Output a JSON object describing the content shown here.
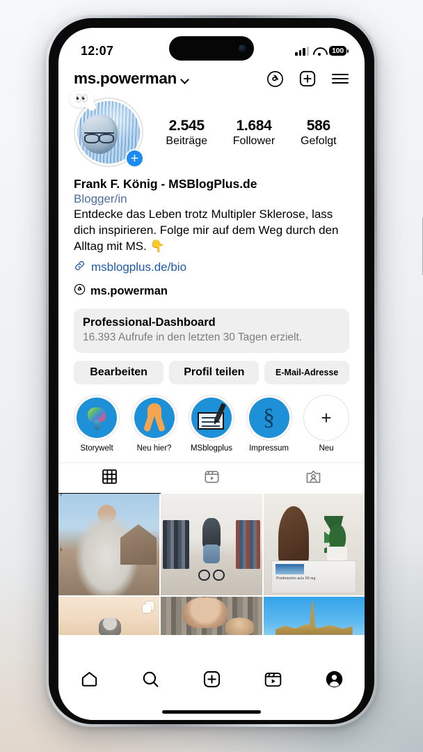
{
  "statusbar": {
    "time": "12:07",
    "battery": "100",
    "signal_icon": "cellular-bars-icon",
    "wifi_icon": "wifi-icon",
    "battery_icon": "battery-icon"
  },
  "header": {
    "username": "ms.powerman",
    "chevron_icon": "chevron-down-icon",
    "threads_icon": "threads-icon",
    "create_icon": "plus-square-icon",
    "menu_icon": "hamburger-menu-icon"
  },
  "profile": {
    "avatar_note": "👀",
    "avatar_add_label": "+",
    "stats": [
      {
        "number": "2.545",
        "label": "Beiträge"
      },
      {
        "number": "1.684",
        "label": "Follower"
      },
      {
        "number": "586",
        "label": "Gefolgt"
      }
    ]
  },
  "bio": {
    "name": "Frank F. König - MSBlogPlus.de",
    "category": "Blogger/in",
    "text": "Entdecke das Leben trotz Multipler Sklerose, lass dich inspirieren. Folge mir auf dem Weg durch den Alltag mit MS. 👇",
    "link_icon": "link-icon",
    "link": "msblogplus.de/bio",
    "threads_icon": "threads-icon",
    "threads_handle": "ms.powerman"
  },
  "dashboard": {
    "title": "Professional-Dashboard",
    "subtitle": "16.393 Aufrufe in den letzten 30 Tagen erzielt."
  },
  "actions": {
    "edit": "Bearbeiten",
    "share": "Profil teilen",
    "email": "E-Mail-Adresse"
  },
  "highlights": [
    {
      "label": "Storywelt",
      "icon": "elephant-icon"
    },
    {
      "label": "Neu hier?",
      "icon": "awareness-ribbon-icon"
    },
    {
      "label": "MSblogplus",
      "icon": "pen-and-card-icon"
    },
    {
      "label": "Impressum",
      "icon": "paragraph-symbol-icon"
    },
    {
      "label": "Neu",
      "icon": "plus-icon"
    }
  ],
  "tabs": [
    {
      "name": "grid",
      "icon": "grid-icon",
      "active": true
    },
    {
      "name": "reels",
      "icon": "reels-icon",
      "active": false
    },
    {
      "name": "tagged",
      "icon": "tagged-person-icon",
      "active": false
    }
  ],
  "grid_posts": [
    {
      "alt": "Mann im grauen Hoodie vor Haus und kahlem Baum",
      "type": "photo"
    },
    {
      "alt": "Person im Rollstuhl in einem Bekleidungsgeschäft",
      "type": "photo"
    },
    {
      "alt": "Buddha-Figur mit Pflanze und Prednisolon acis 50 mg Medikamentenschachtel",
      "type": "photo"
    },
    {
      "alt": "Person vor hellem Hintergrund",
      "type": "carousel"
    },
    {
      "alt": "Selfie im Aufzug",
      "type": "photo"
    },
    {
      "alt": "Kathedrale vor blauem Himmel",
      "type": "photo"
    }
  ],
  "bottom_nav": [
    {
      "name": "home",
      "icon": "home-icon",
      "active": false
    },
    {
      "name": "search",
      "icon": "search-icon",
      "active": false
    },
    {
      "name": "create",
      "icon": "plus-square-icon",
      "active": false
    },
    {
      "name": "reels",
      "icon": "reels-icon",
      "active": false
    },
    {
      "name": "profile",
      "icon": "profile-avatar-icon",
      "active": true
    }
  ],
  "colors": {
    "accent_blue": "#1e90d8",
    "link_blue": "#1d58a8",
    "category_blue": "#4a6f9e",
    "chip_gray": "#efefef",
    "muted_text": "#7c7c7e",
    "add_badge_blue": "#1a8cf0",
    "ribbon_orange": "#f5a44f"
  }
}
